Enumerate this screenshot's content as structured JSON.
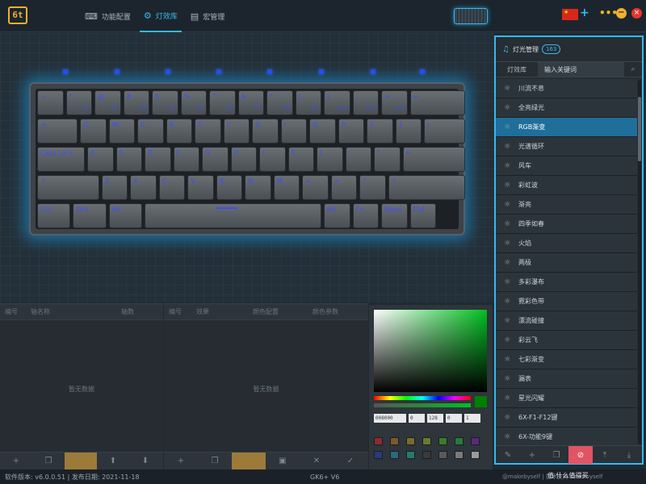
{
  "header": {
    "logo_text": "6t",
    "nav": [
      {
        "label": "功能配置",
        "icon": "keyboard-icon"
      },
      {
        "label": "灯效库",
        "icon": "gear-icon"
      },
      {
        "label": "宏管理",
        "icon": "document-icon"
      }
    ],
    "active_tab": "灯效库",
    "flag_label": "★",
    "add_label": "+",
    "more_label": "•••",
    "minimize_label": "−",
    "close_label": "×"
  },
  "keyboard": {
    "rows": [
      [
        {
          "l": "~",
          "s": "`"
        },
        {
          "l": "!",
          "s": "F1"
        },
        {
          "l": "@",
          "s": "F2"
        },
        {
          "l": "#",
          "s": "F3"
        },
        {
          "l": "$",
          "s": "F4"
        },
        {
          "l": "%",
          "s": "F5"
        },
        {
          "l": "^",
          "s": "F6"
        },
        {
          "l": "&",
          "s": "F7"
        },
        {
          "l": "*",
          "s": "F8"
        },
        {
          "l": "(",
          "s": "F9"
        },
        {
          "l": ")",
          "s": "F10"
        },
        {
          "l": "_",
          "s": "F11"
        },
        {
          "l": "+",
          "s": "F12"
        },
        {
          "l": "←",
          "s": ""
        }
      ],
      [
        {
          "l": "⇥",
          "s": ""
        },
        {
          "l": "Q",
          "s": ""
        },
        {
          "l": "W",
          "s": ""
        },
        {
          "l": "E",
          "s": ""
        },
        {
          "l": "R",
          "s": ""
        },
        {
          "l": "T",
          "s": ""
        },
        {
          "l": "Y",
          "s": ""
        },
        {
          "l": "U",
          "s": ""
        },
        {
          "l": "I",
          "s": ""
        },
        {
          "l": "O",
          "s": ""
        },
        {
          "l": "P",
          "s": ""
        },
        {
          "l": "{",
          "s": ""
        },
        {
          "l": "}",
          "s": ""
        },
        {
          "l": "|",
          "s": ""
        }
      ],
      [
        {
          "l": "Caps Lock",
          "s": ""
        },
        {
          "l": "A",
          "s": ""
        },
        {
          "l": "S",
          "s": ""
        },
        {
          "l": "D",
          "s": ""
        },
        {
          "l": "F",
          "s": ""
        },
        {
          "l": "G",
          "s": ""
        },
        {
          "l": "H",
          "s": ""
        },
        {
          "l": "J",
          "s": ""
        },
        {
          "l": "K",
          "s": ""
        },
        {
          "l": "L",
          "s": ""
        },
        {
          "l": ":",
          "s": ""
        },
        {
          "l": "\"",
          "s": ""
        },
        {
          "l": "↵",
          "s": ""
        }
      ],
      [
        {
          "l": "⇧",
          "s": ""
        },
        {
          "l": "Z",
          "s": ""
        },
        {
          "l": "X",
          "s": ""
        },
        {
          "l": "C",
          "s": ""
        },
        {
          "l": "V",
          "s": ""
        },
        {
          "l": "B",
          "s": ""
        },
        {
          "l": "N",
          "s": ""
        },
        {
          "l": "M",
          "s": ""
        },
        {
          "l": "<",
          "s": ""
        },
        {
          "l": ">",
          "s": ""
        },
        {
          "l": "?",
          "s": ""
        },
        {
          "l": "⇧",
          "s": ""
        }
      ],
      [
        {
          "l": "Ctrl",
          "s": ""
        },
        {
          "l": "Win",
          "s": ""
        },
        {
          "l": "Alt",
          "s": ""
        },
        {
          "l": "",
          "s": ""
        },
        {
          "l": "Alt",
          "s": ""
        },
        {
          "l": "Fn",
          "s": ""
        },
        {
          "l": "Menu",
          "s": ""
        },
        {
          "l": "Ctrl",
          "s": ""
        }
      ]
    ]
  },
  "layer_panel": {
    "columns": [
      "编号",
      "轴名称",
      "轴数"
    ],
    "empty_text": "暂无数据",
    "footer_buttons": [
      "+",
      "❐",
      "",
      "⬆",
      "⬇"
    ]
  },
  "effect_panel": {
    "columns": [
      "编号",
      "效果",
      "颜色配置",
      "颜色参数"
    ],
    "empty_text": "暂无数据",
    "footer_buttons": [
      "+",
      "❐",
      "",
      "▣",
      "✕",
      "✓"
    ]
  },
  "color_picker": {
    "hex_value": "008000",
    "r": "0",
    "g": "128",
    "b": "0",
    "a": "1",
    "selected_color": "#008000",
    "swatches": [
      "#8b2b34",
      "#7a5a2a",
      "#7a6a2a",
      "#6a7a2a",
      "#3c7a2a",
      "#2a7a3a",
      "#5a2a7a",
      "#2a3a7a",
      "#2a6a7a",
      "#2a7a6a",
      "#3a3a3a",
      "#5a5a5a",
      "#7a7a7a",
      "#9a9a9a"
    ]
  },
  "sidebar": {
    "title": "灯光管理",
    "count": "163",
    "tab_label": "灯效库",
    "search_placeholder": "输入关键词",
    "selected": "RGB渐变",
    "effects": [
      "川流不息",
      "全亮绿光",
      "RGB渐变",
      "光谱循环",
      "风车",
      "彩虹波",
      "渐亮",
      "四季如春",
      "火焰",
      "两极",
      "多彩瀑布",
      "霓彩色带",
      "漂流碰撞",
      "彩云飞",
      "七彩渐变",
      "漏表",
      "星光闪耀",
      "6X-F1-F12键",
      "6X-功能9键"
    ],
    "footer_buttons": [
      "✎",
      "+",
      "❐",
      "⊘",
      "⤒",
      "⤓"
    ]
  },
  "status": {
    "version": "软件版本: v6.0.0.51 | 发布日期: 2021-11-18",
    "device": "GK6+ V6",
    "credit": "@makebyself | 技术支持 makebyself"
  },
  "watermark": "值 什么值得买"
}
